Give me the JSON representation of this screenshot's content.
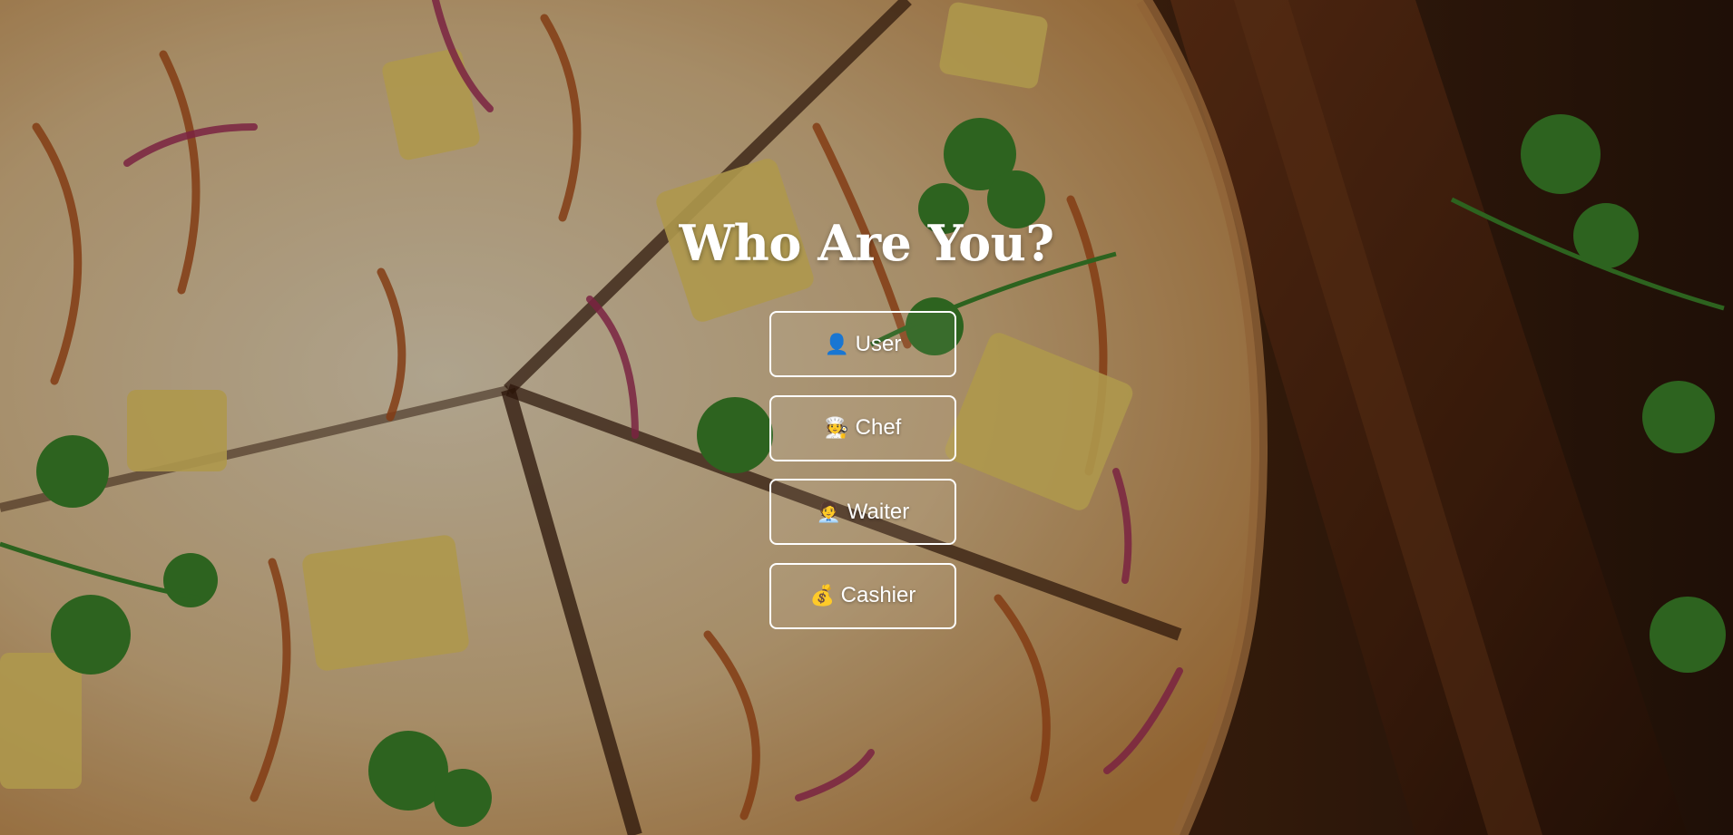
{
  "page": {
    "title": "Who Are You?"
  },
  "roles": [
    {
      "label": "User",
      "icon": "bust-in-silhouette-icon",
      "glyph": "👤"
    },
    {
      "label": "Chef",
      "icon": "cook-icon",
      "glyph": "🧑‍🍳"
    },
    {
      "label": "Waiter",
      "icon": "office-worker-icon",
      "glyph": "🧑‍💼"
    },
    {
      "label": "Cashier",
      "icon": "money-bag-icon",
      "glyph": "💰"
    }
  ],
  "colors": {
    "text": "#ffffff",
    "button_border": "#ffffff",
    "overlay": "rgba(0,0,0,0.28)"
  }
}
